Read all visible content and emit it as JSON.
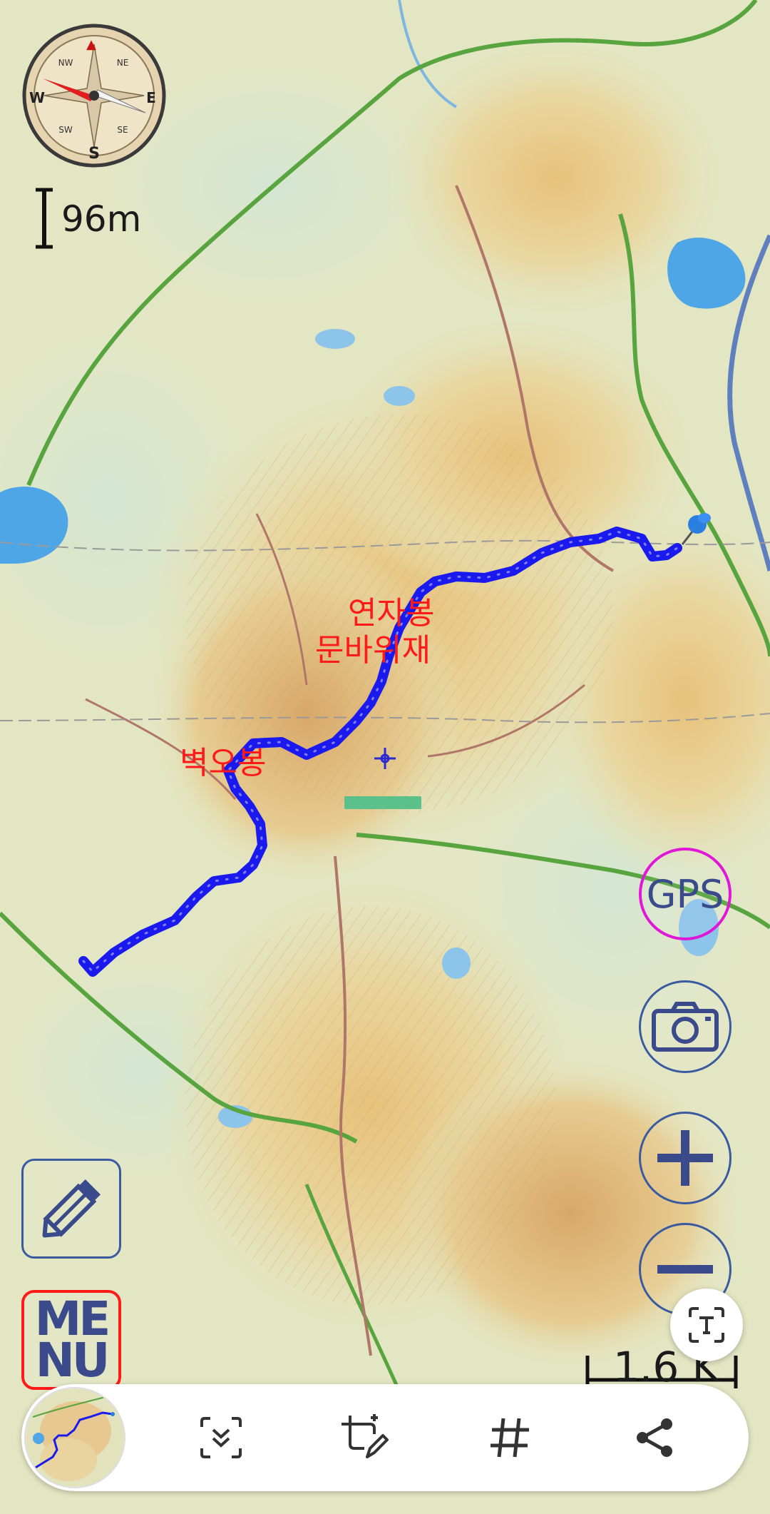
{
  "map": {
    "labels": [
      {
        "id": "yeonjabong",
        "text": "연자봉"
      },
      {
        "id": "munbawijae",
        "text": "문바위재"
      },
      {
        "id": "byeokobong",
        "text": "벽오봉"
      }
    ],
    "route_color": "#1a1aee",
    "label_color": "#ff1a1a"
  },
  "scale": {
    "top_label": "96m",
    "bottom_label": "1.6 K"
  },
  "controls": {
    "compass_icon": "compass-icon",
    "gps_label": "GPS",
    "gps_ring_color": "#e016d8",
    "camera_icon": "camera-icon",
    "zoom_in_icon": "plus-icon",
    "zoom_out_icon": "minus-icon",
    "edit_icon": "pencil-icon",
    "menu_label_line1": "ME",
    "menu_label_line2": "NU",
    "menu_border_color": "#ff1a1a"
  },
  "bottom_bar": {
    "items": [
      {
        "id": "thumbnail",
        "icon": "map-thumbnail"
      },
      {
        "id": "smart-select",
        "icon": "scan-select-icon"
      },
      {
        "id": "crop-edit",
        "icon": "crop-edit-icon"
      },
      {
        "id": "tag",
        "icon": "hash-icon"
      },
      {
        "id": "share",
        "icon": "share-icon"
      }
    ],
    "ocr_icon": "text-extract-icon"
  }
}
